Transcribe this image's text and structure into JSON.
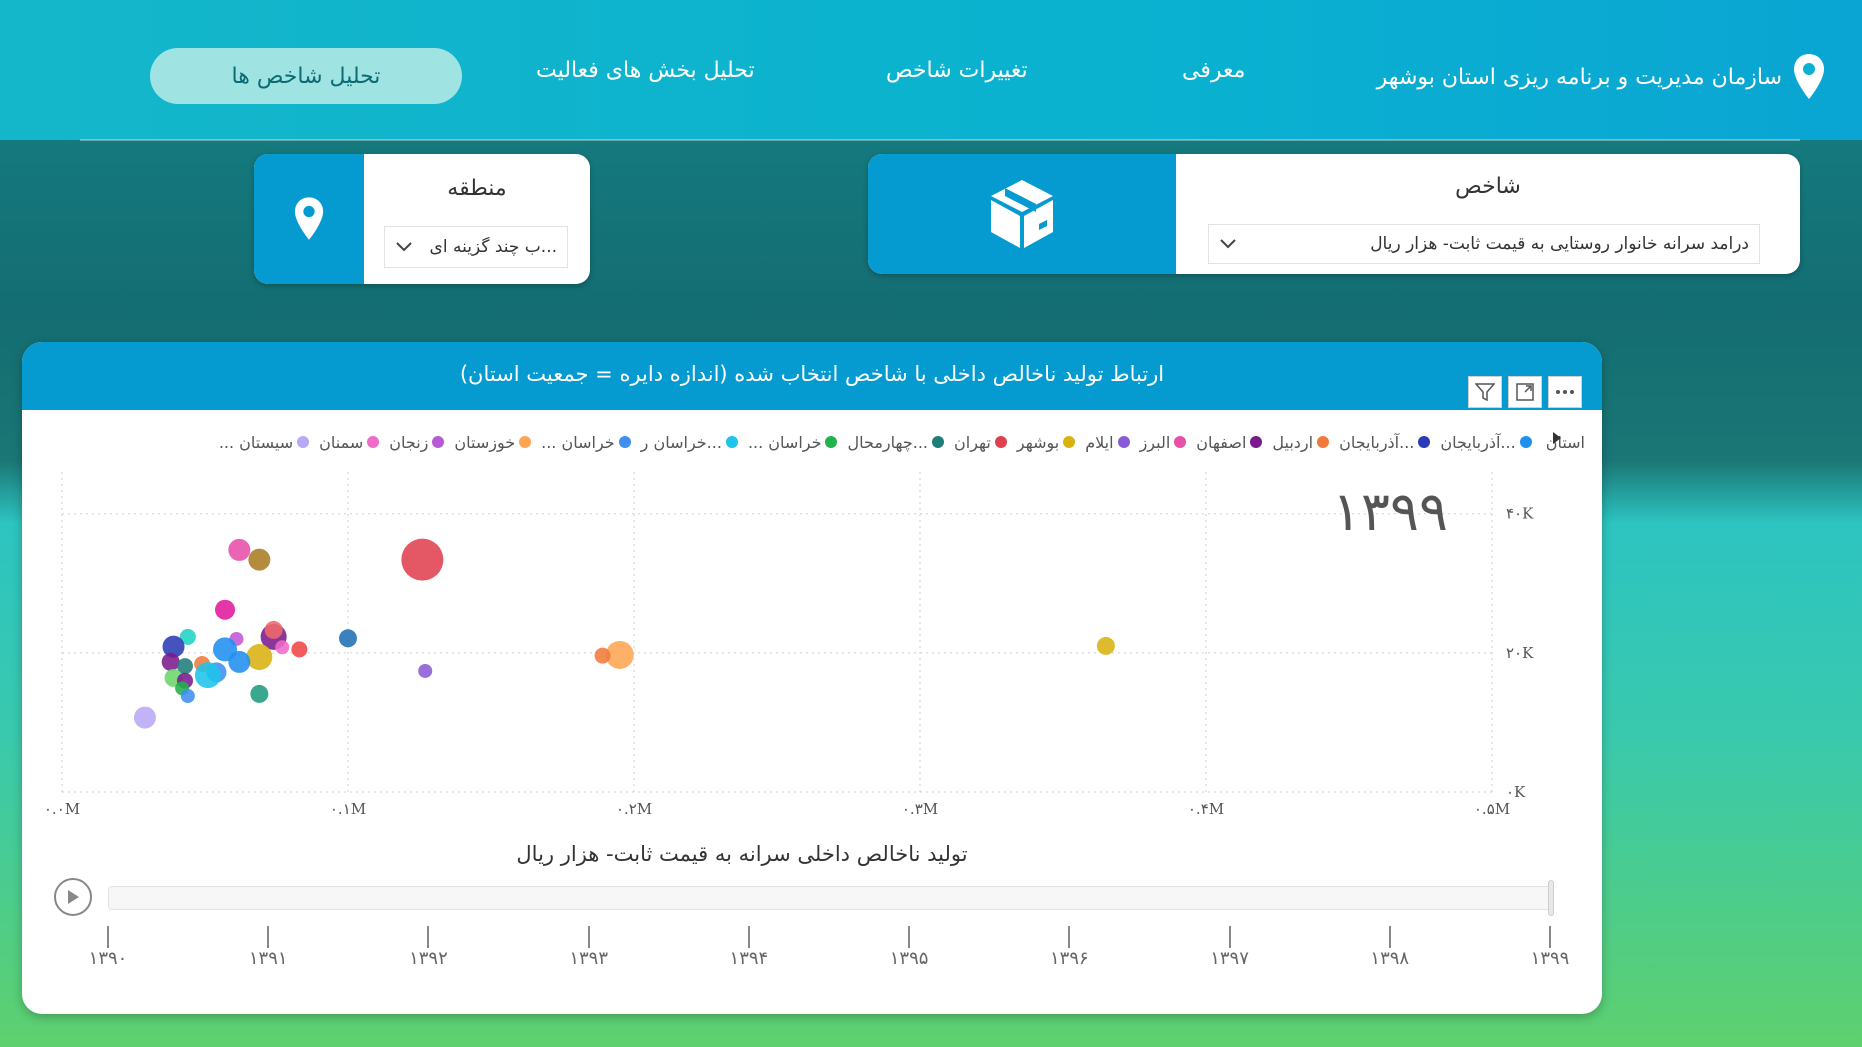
{
  "header": {
    "brand": "سازمان مدیریت و برنامه ریزی استان بوشهر",
    "nav": {
      "intro": "معرفی",
      "changes": "تغییرات شاخص",
      "sectors": "تحلیل بخش های فعالیت",
      "analysis": "تحلیل شاخص ها"
    }
  },
  "slicers": {
    "indicator": {
      "title": "شاخص",
      "value": "درامد سرانه خانوار روستایی به قیمت ثابت- هزار ریال"
    },
    "region": {
      "title": "منطقه",
      "value": "...ب چند گزینه ای"
    }
  },
  "chart": {
    "title": "ارتباط تولید ناخالص داخلی با شاخص انتخاب شده (اندازه دایره = جمعیت استان)",
    "legend_title": "استان",
    "legend": [
      {
        "name": "...آذربایجان",
        "color": "#1f8ff0"
      },
      {
        "name": "...آذربایجان",
        "color": "#2a3bb5"
      },
      {
        "name": "اردبیل",
        "color": "#f07a3c"
      },
      {
        "name": "اصفهان",
        "color": "#7a1a8c"
      },
      {
        "name": "البرز",
        "color": "#e84fa8"
      },
      {
        "name": "ایلام",
        "color": "#8a5bd6"
      },
      {
        "name": "بوشهر",
        "color": "#d9b20f"
      },
      {
        "name": "تهران",
        "color": "#e0404e"
      },
      {
        "name": "...چهارمحال",
        "color": "#1f7d7a"
      },
      {
        "name": "خراسان ...",
        "color": "#22b24c"
      },
      {
        "name": "...خراسان ر",
        "color": "#1ec4ea"
      },
      {
        "name": "خراسان ...",
        "color": "#3f8ef0"
      },
      {
        "name": "خوزستان",
        "color": "#ffa552"
      },
      {
        "name": "زنجان",
        "color": "#b65ad6"
      },
      {
        "name": "سمنان",
        "color": "#f06ac8"
      },
      {
        "name": "سیستان ...",
        "color": "#b9a8f5"
      }
    ],
    "play_year": "۱۳۹۹",
    "x_axis_title": "تولید ناخالص داخلی سرانه به قیمت ثابت- هزار ریال",
    "timeline_years": [
      "۱۳۹۰",
      "۱۳۹۱",
      "۱۳۹۲",
      "۱۳۹۳",
      "۱۳۹۴",
      "۱۳۹۵",
      "۱۳۹۶",
      "۱۳۹۷",
      "۱۳۹۸",
      "۱۳۹۹"
    ]
  },
  "chart_data": {
    "type": "scatter",
    "x_ticks": [
      "۰.۰M",
      "۰.۱M",
      "۰.۲M",
      "۰.۳M",
      "۰.۴M",
      "۰.۵M"
    ],
    "y_ticks": [
      "۰K",
      "۲۰K",
      "۴۰K"
    ],
    "xlim": [
      0,
      500000
    ],
    "ylim": [
      0,
      40000
    ],
    "xlabel": "تولید ناخالص داخلی سرانه به قیمت ثابت- هزار ریال",
    "grid": true,
    "points": [
      {
        "x": 126000,
        "y": 33400,
        "size": 21,
        "color": "#e0404e"
      },
      {
        "x": 365000,
        "y": 21000,
        "size": 9,
        "color": "#d9b20f"
      },
      {
        "x": 195000,
        "y": 19700,
        "size": 14,
        "color": "#ffa552"
      },
      {
        "x": 189000,
        "y": 19600,
        "size": 8,
        "color": "#f07a3c"
      },
      {
        "x": 100000,
        "y": 22100,
        "size": 9,
        "color": "#1f6fb5"
      },
      {
        "x": 127000,
        "y": 17400,
        "size": 7,
        "color": "#8a5bd6"
      },
      {
        "x": 62000,
        "y": 34800,
        "size": 11,
        "color": "#e84fa8"
      },
      {
        "x": 69000,
        "y": 33400,
        "size": 11,
        "color": "#a87d22"
      },
      {
        "x": 57000,
        "y": 26200,
        "size": 10,
        "color": "#e01a9a"
      },
      {
        "x": 74000,
        "y": 22300,
        "size": 13,
        "color": "#7a1a8c"
      },
      {
        "x": 74000,
        "y": 23300,
        "size": 9,
        "color": "#f06a6a"
      },
      {
        "x": 83000,
        "y": 20500,
        "size": 8,
        "color": "#f04646"
      },
      {
        "x": 77000,
        "y": 20800,
        "size": 7,
        "color": "#f06ac8"
      },
      {
        "x": 44000,
        "y": 22300,
        "size": 8,
        "color": "#1ed4c4"
      },
      {
        "x": 61000,
        "y": 22000,
        "size": 7,
        "color": "#c058d6"
      },
      {
        "x": 39000,
        "y": 20900,
        "size": 11,
        "color": "#2a3bb5"
      },
      {
        "x": 57000,
        "y": 20500,
        "size": 12,
        "color": "#1f8ff0"
      },
      {
        "x": 69000,
        "y": 19400,
        "size": 13,
        "color": "#d9b20f"
      },
      {
        "x": 62000,
        "y": 18700,
        "size": 11,
        "color": "#1f8ff0"
      },
      {
        "x": 38000,
        "y": 18700,
        "size": 9,
        "color": "#7a1a8c"
      },
      {
        "x": 49000,
        "y": 18400,
        "size": 8,
        "color": "#f07a3c"
      },
      {
        "x": 43000,
        "y": 18100,
        "size": 8,
        "color": "#1f7d7a"
      },
      {
        "x": 54000,
        "y": 17200,
        "size": 10,
        "color": "#3f8ef0"
      },
      {
        "x": 51000,
        "y": 16800,
        "size": 13,
        "color": "#1ec4ea"
      },
      {
        "x": 39000,
        "y": 16400,
        "size": 9,
        "color": "#6bd66b"
      },
      {
        "x": 43000,
        "y": 16000,
        "size": 8,
        "color": "#7a1a8c"
      },
      {
        "x": 42000,
        "y": 14900,
        "size": 7,
        "color": "#22b24c"
      },
      {
        "x": 44000,
        "y": 13800,
        "size": 7,
        "color": "#3f8ef0"
      },
      {
        "x": 69000,
        "y": 14100,
        "size": 9,
        "color": "#1f9c7e"
      },
      {
        "x": 29000,
        "y": 10700,
        "size": 11,
        "color": "#b9a8f5"
      }
    ]
  }
}
